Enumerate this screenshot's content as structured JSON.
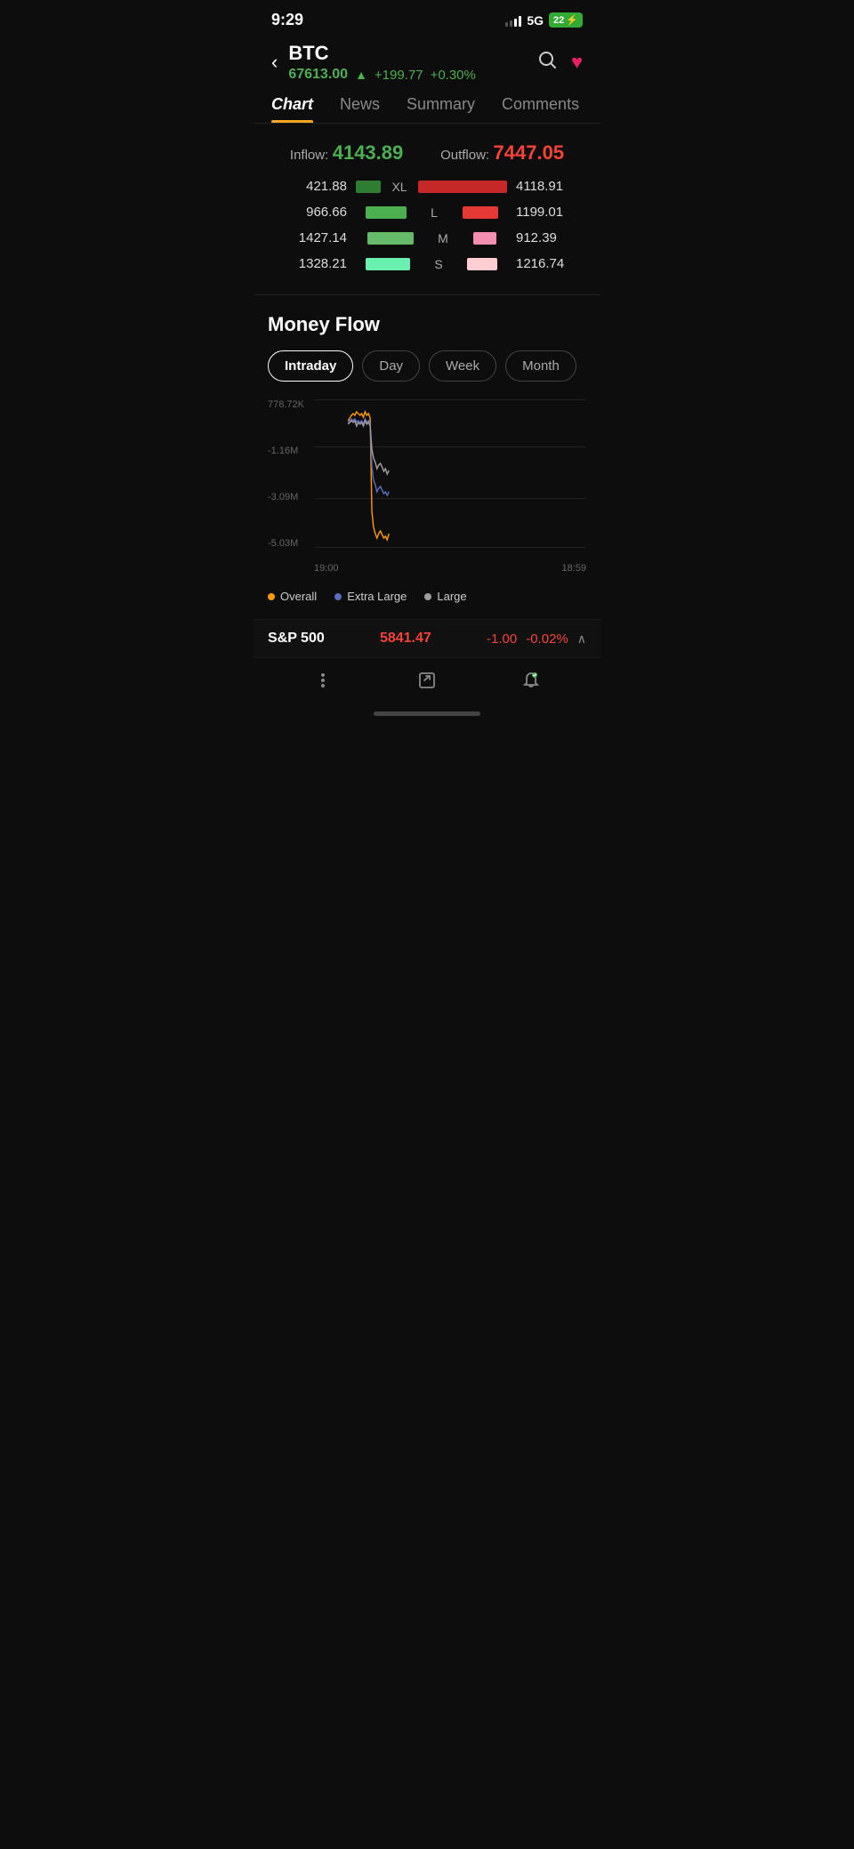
{
  "statusBar": {
    "time": "9:29",
    "signal": "5G",
    "battery": "22"
  },
  "header": {
    "backLabel": "<",
    "coinName": "BTC",
    "price": "67613.00",
    "arrow": "▲",
    "change": "+199.77",
    "changePct": "+0.30%"
  },
  "tabs": {
    "items": [
      {
        "label": "Chart",
        "active": true
      },
      {
        "label": "News",
        "active": false
      },
      {
        "label": "Summary",
        "active": false
      },
      {
        "label": "Comments",
        "active": false
      }
    ]
  },
  "flowSection": {
    "inflowLabel": "Inflow:",
    "inflowValue": "4143.89",
    "outflowLabel": "Outflow:",
    "outflowValue": "7447.05",
    "rows": [
      {
        "leftVal": "421.88",
        "size": "XL",
        "rightVal": "4118.91"
      },
      {
        "leftVal": "966.66",
        "size": "L",
        "rightVal": "1199.01"
      },
      {
        "leftVal": "1427.14",
        "size": "M",
        "rightVal": "912.39"
      },
      {
        "leftVal": "1328.21",
        "size": "S",
        "rightVal": "1216.74"
      }
    ]
  },
  "moneyFlow": {
    "title": "Money Flow",
    "periodTabs": [
      "Intraday",
      "Day",
      "Week",
      "Month"
    ],
    "activePeriod": "Intraday",
    "chart": {
      "yLabels": [
        "778.72K",
        "-1.16M",
        "-3.09M",
        "-5.03M"
      ],
      "xLabels": [
        "19:00",
        "18:59"
      ]
    },
    "legend": [
      {
        "dot": "orange",
        "label": "Overall"
      },
      {
        "dot": "blue",
        "label": "Extra Large"
      },
      {
        "dot": "gray",
        "label": "Large"
      }
    ]
  },
  "bottomTicker": {
    "name": "S&P 500",
    "price": "5841.47",
    "change": "-1.00",
    "changePct": "-0.02%"
  },
  "bottomNav": {
    "icons": [
      "⋮",
      "↗",
      "🔔"
    ]
  },
  "icons": {
    "back": "‹",
    "search": "○",
    "heart": "♥",
    "more": "⋮",
    "share": "↗",
    "bell": "🔔",
    "chevronUp": "∧"
  }
}
